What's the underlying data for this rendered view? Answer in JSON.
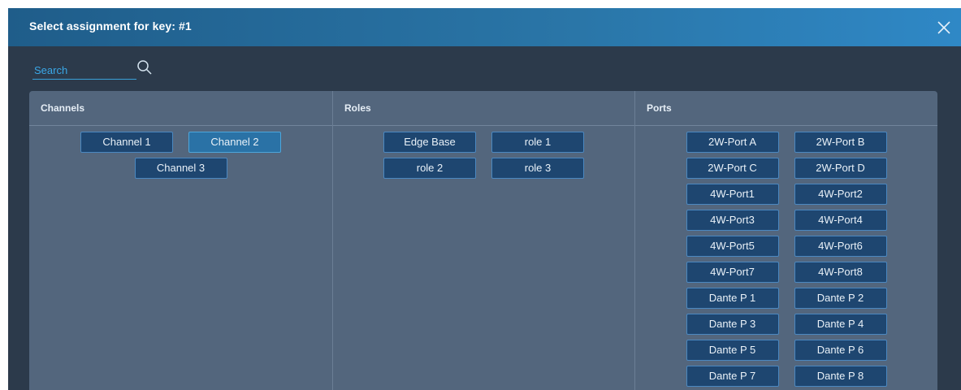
{
  "dialog": {
    "title": "Select assignment for key: #1",
    "close_icon": "close-icon"
  },
  "search": {
    "placeholder": "Search",
    "value": "",
    "icon": "search-icon"
  },
  "columns": {
    "channels": {
      "header": "Channels",
      "items": [
        "Channel 1",
        "Channel 2",
        "Channel 3"
      ],
      "selected": "Channel 2"
    },
    "roles": {
      "header": "Roles",
      "items": [
        "Edge Base",
        "role 1",
        "role 2",
        "role 3"
      ]
    },
    "ports": {
      "header": "Ports",
      "items": [
        "2W-Port A",
        "2W-Port B",
        "2W-Port C",
        "2W-Port D",
        "4W-Port1",
        "4W-Port2",
        "4W-Port3",
        "4W-Port4",
        "4W-Port5",
        "4W-Port6",
        "4W-Port7",
        "4W-Port8",
        "Dante P 1",
        "Dante P 2",
        "Dante P 3",
        "Dante P 4",
        "Dante P 5",
        "Dante P 6",
        "Dante P 7",
        "Dante P 8"
      ]
    }
  },
  "colors": {
    "title_bar_start": "#1f5d8a",
    "title_bar_end": "#2f88c6",
    "dialog_bg": "#2c3a4b",
    "grid_bg": "#53667d",
    "chip_bg": "#1e4670",
    "chip_selected_bg": "#2a72a6",
    "accent": "#3aa8e8"
  }
}
